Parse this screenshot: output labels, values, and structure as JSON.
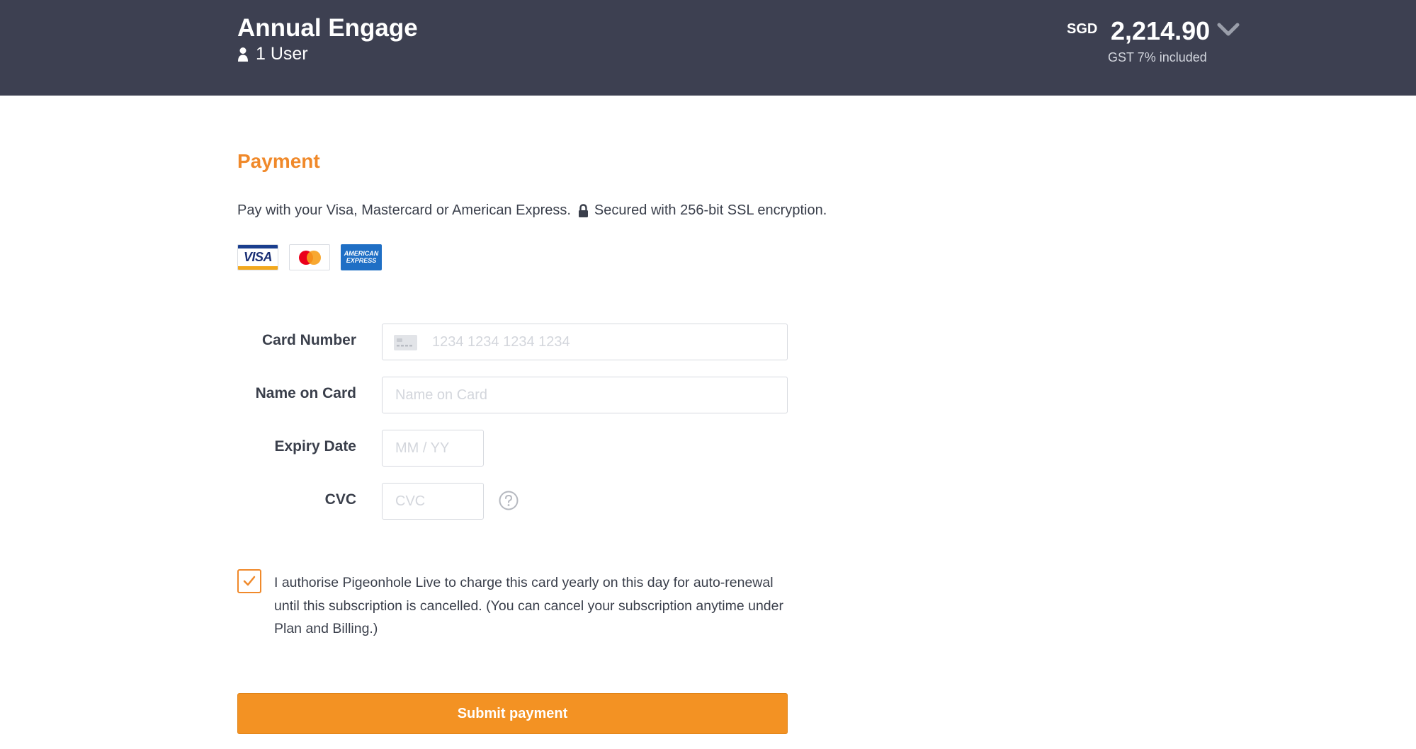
{
  "header": {
    "plan_name": "Annual Engage",
    "users": "1 User",
    "currency": "SGD",
    "amount": "2,214.90",
    "tax_note": "GST 7% included"
  },
  "payment": {
    "title": "Payment",
    "description": "Pay with your Visa, Mastercard or American Express.",
    "security_note": "Secured with 256-bit SSL encryption.",
    "card_brands": {
      "visa": "VISA",
      "amex_line1": "AMERICAN",
      "amex_line2": "EXPRESS"
    }
  },
  "form": {
    "card_number": {
      "label": "Card Number",
      "placeholder": "1234 1234 1234 1234",
      "value": ""
    },
    "name_on_card": {
      "label": "Name on Card",
      "placeholder": "Name on Card",
      "value": ""
    },
    "expiry_date": {
      "label": "Expiry Date",
      "placeholder": "MM / YY",
      "value": ""
    },
    "cvc": {
      "label": "CVC",
      "placeholder": "CVC",
      "value": ""
    }
  },
  "consent": {
    "checked": true,
    "text": "I authorise Pigeonhole Live to charge this card yearly on this day for auto-renewal until this subscription is cancelled. (You can cancel your subscription anytime under Plan and Billing.)"
  },
  "submit": {
    "label": "Submit payment"
  },
  "colors": {
    "header_bg": "#3d4051",
    "accent": "#f0892a",
    "button": "#f39223"
  },
  "icons": [
    "user-icon",
    "chevron-down-icon",
    "lock-icon",
    "credit-card-icon",
    "question-circle-icon",
    "check-icon"
  ]
}
